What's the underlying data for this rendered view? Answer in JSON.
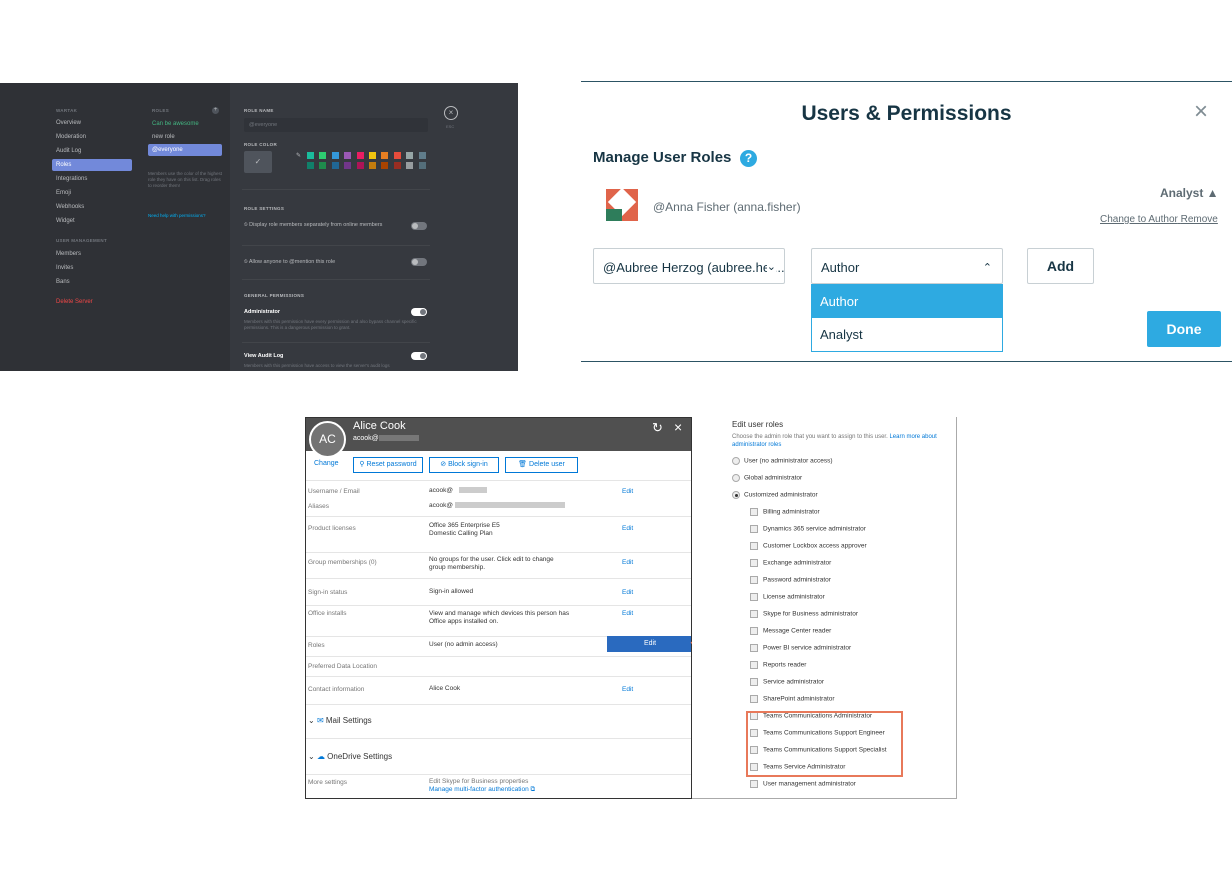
{
  "p1": {
    "server_section": "WARTAK",
    "nav": [
      "Overview",
      "Moderation",
      "Audit Log",
      "Roles",
      "Integrations",
      "Emoji",
      "Webhooks",
      "Widget"
    ],
    "user_section": "USER MANAGEMENT",
    "nav2": [
      "Members",
      "Invites",
      "Bans"
    ],
    "delete": "Delete Server",
    "roles_header": "ROLES",
    "roles": [
      "Can be awesome",
      "new role",
      "@everyone"
    ],
    "roles_note": "Members use the color of the highest role they have on this list. Drag roles to reorder them!",
    "help_link": "Need help with permissions?",
    "role_name_label": "ROLE NAME",
    "role_name_value": "@everyone",
    "role_color_label": "ROLE COLOR",
    "esc": "ESC",
    "role_settings": "ROLE SETTINGS",
    "setting1": "Display role members separately from online members",
    "setting2": "Allow anyone to @mention this role",
    "general": "GENERAL PERMISSIONS",
    "admin": "Administrator",
    "admin_desc": "Members with this permission have every permission and also bypass channel specific permissions. This is a dangerous permission to grant.",
    "audit": "View Audit Log",
    "audit_desc": "Members with this permission have access to view the server's audit logs",
    "swatches": [
      "#1abc9c",
      "#2ecc71",
      "#3498db",
      "#9b59b6",
      "#e91e63",
      "#f1c40f",
      "#e67e22",
      "#e74c3c",
      "#95a5a6",
      "#607d8b",
      "#11806a",
      "#1f8b4c",
      "#206694",
      "#71368a",
      "#ad1457",
      "#c27c0e",
      "#a84300",
      "#992d22",
      "#979c9f",
      "#546e7a"
    ]
  },
  "p2": {
    "title": "Users & Permissions",
    "subtitle": "Manage User Roles",
    "help": "?",
    "user": "@Anna Fisher (anna.fisher)",
    "role": "Analyst ▲",
    "change": "Change to Author",
    "remove": "Remove",
    "select_user": "@Aubree Herzog (aubree.her...",
    "select_role": "Author",
    "add": "Add",
    "options": [
      "Author",
      "Analyst"
    ],
    "done": "Done",
    "accent": "#2eaae1"
  },
  "p3": {
    "name": "Alice Cook",
    "email": "acook@",
    "initials": "AC",
    "change": "Change",
    "reset": "Reset password",
    "block": "Block sign-in",
    "delete": "Delete user",
    "rows": [
      {
        "k": "Username / Email",
        "v": "acook@",
        "e": "Edit"
      },
      {
        "k": "Aliases",
        "v": "acook@",
        "e": ""
      },
      {
        "k": "Product licenses",
        "v": "Office 365 Enterprise E5",
        "v2": "Domestic Calling Plan",
        "e": "Edit"
      },
      {
        "k": "Group memberships (0)",
        "v": "No groups for the user. Click edit to change",
        "v2": "group membership.",
        "e": "Edit"
      },
      {
        "k": "Sign-in status",
        "v": "Sign-in allowed",
        "e": "Edit"
      },
      {
        "k": "Office installs",
        "v": "View and manage which devices this person has",
        "v2": "Office apps installed on.",
        "e": "Edit"
      },
      {
        "k": "Roles",
        "v": "User (no admin access)",
        "e": "Edit"
      },
      {
        "k": "Preferred Data Location",
        "v": "",
        "e": ""
      },
      {
        "k": "Contact information",
        "v": "Alice Cook",
        "e": "Edit"
      }
    ],
    "mail": "Mail Settings",
    "onedrive": "OneDrive Settings",
    "more": "More settings",
    "more_v1": "Edit Skype for Business properties",
    "more_v2": "Manage multi-factor authentication"
  },
  "p4": {
    "title": "Edit user roles",
    "desc": "Choose the admin role that you want to assign to this user.",
    "learn": "Learn more about administrator roles",
    "radios": [
      "User (no administrator access)",
      "Global administrator",
      "Customized administrator"
    ],
    "checks": [
      "Billing administrator",
      "Dynamics 365 service administrator",
      "Customer Lockbox access approver",
      "Exchange administrator",
      "Password administrator",
      "License administrator",
      "Skype for Business administrator",
      "Message Center reader",
      "Power BI service administrator",
      "Reports reader",
      "Service administrator",
      "SharePoint administrator",
      "Teams Communications Administrator",
      "Teams Communications Support Engineer",
      "Teams Communications Support Specialist",
      "Teams Service Administrator",
      "User management administrator"
    ],
    "highlight": "#e8795a"
  }
}
